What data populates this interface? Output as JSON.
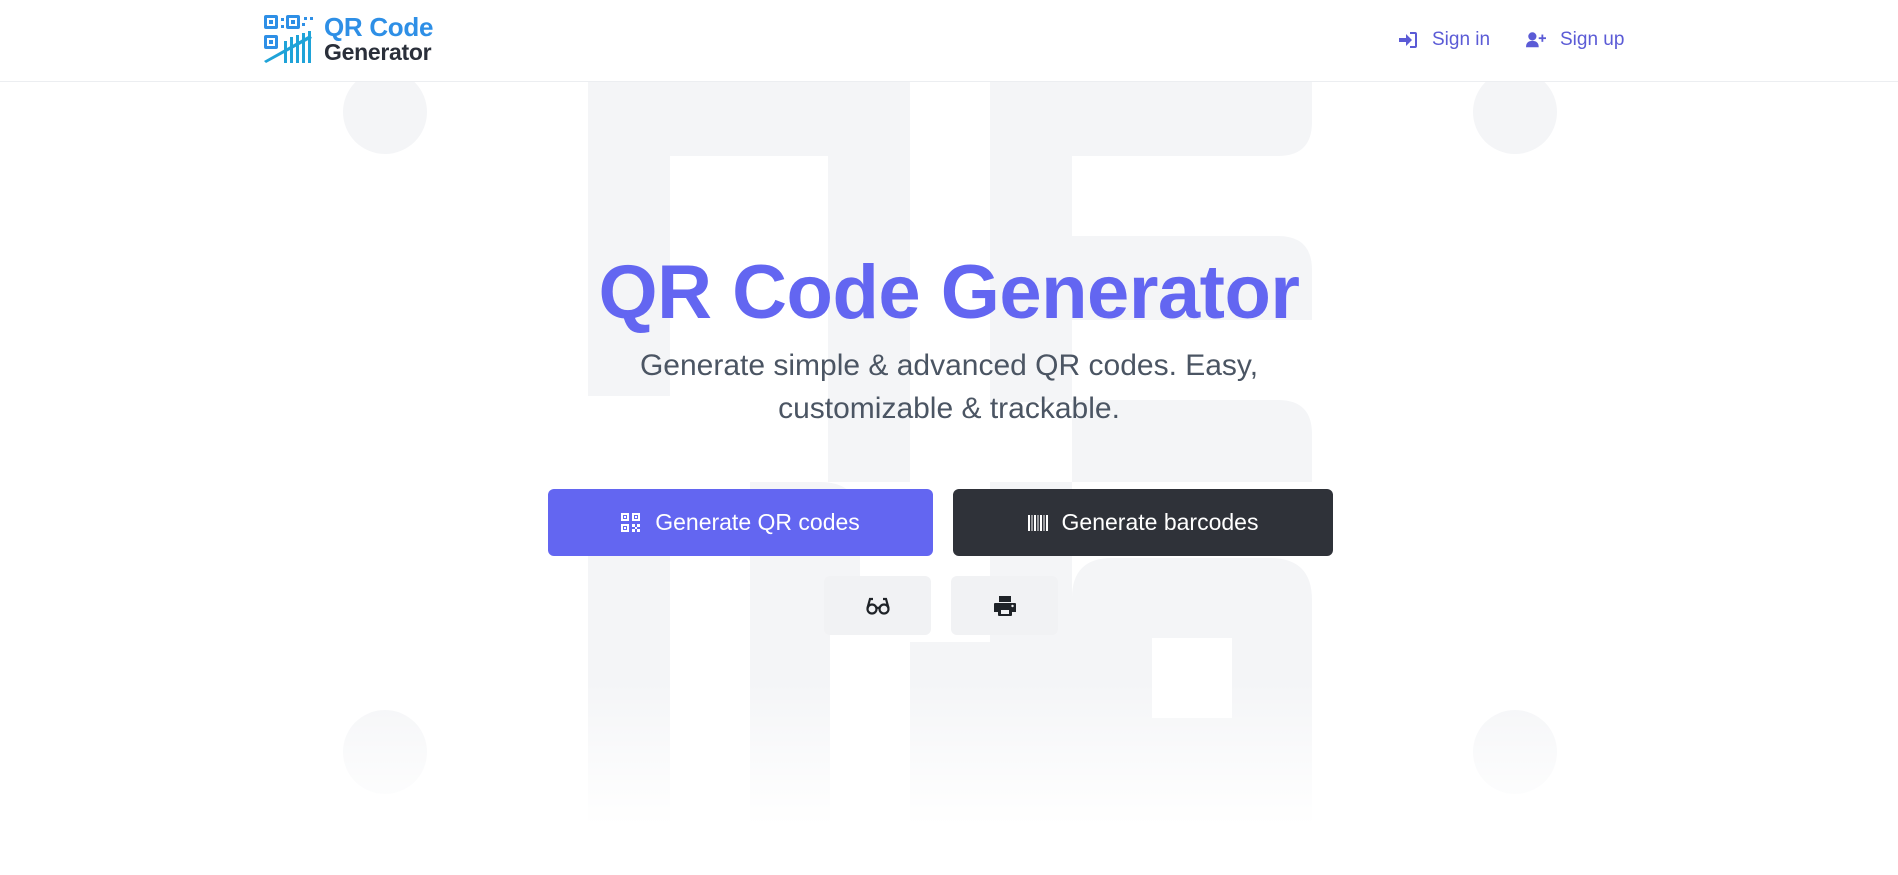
{
  "header": {
    "logo": {
      "line1": "QR Code",
      "line2": "Generator"
    },
    "nav": {
      "signin": {
        "label": "Sign in",
        "icon": "sign-in-icon"
      },
      "signup": {
        "label": "Sign up",
        "icon": "user-plus-icon"
      }
    }
  },
  "hero": {
    "title": "QR Code Generator",
    "subtitle": "Generate simple & advanced QR codes. Easy, customizable & trackable.",
    "primary_button": {
      "label": "Generate QR codes",
      "icon": "qrcode-icon"
    },
    "secondary_button": {
      "label": "Generate barcodes",
      "icon": "barcode-icon"
    },
    "icon_buttons": [
      {
        "icon": "glasses-icon"
      },
      {
        "icon": "print-icon"
      }
    ]
  },
  "colors": {
    "brand_primary": "#6366f1",
    "dark_button": "#2f3239",
    "nav_link": "#5b5bd6",
    "logo_blue": "#2e8fe6",
    "subtitle_text": "#4b5563",
    "background_art": "#f4f5f7"
  }
}
